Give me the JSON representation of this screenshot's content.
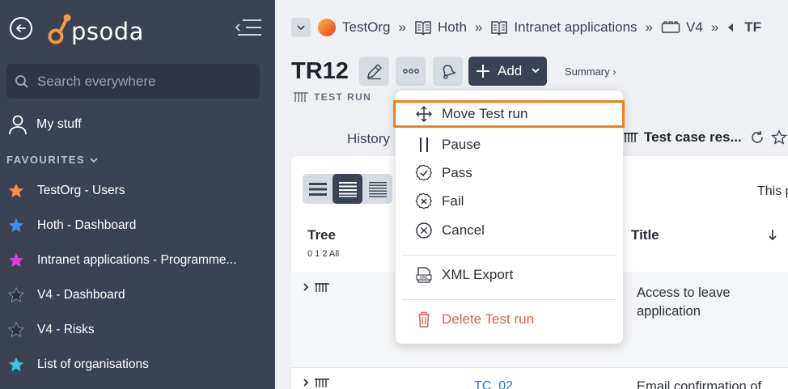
{
  "sidebar": {
    "logo_text": "psoda",
    "search_placeholder": "Search everywhere",
    "my_stuff": "My stuff",
    "favourites_header": "FAVOURITES",
    "favourites": [
      {
        "label": "TestOrg - Users",
        "star_color": "#f0904a"
      },
      {
        "label": "Hoth - Dashboard",
        "star_color": "#3b8fe8"
      },
      {
        "label": "Intranet applications - Programme...",
        "star_color": "#d63fd6"
      },
      {
        "label": "V4 - Dashboard",
        "star_color": "#2a2f3a"
      },
      {
        "label": "V4 - Risks",
        "star_color": "#2a2f3a"
      },
      {
        "label": "List of organisations",
        "star_color": "#3ec6d6"
      }
    ],
    "colors": {
      "bg": "#3b4252",
      "search_bg": "#2f3544"
    }
  },
  "breadcrumb": {
    "items": [
      {
        "label": "TestOrg",
        "icon": "org-logo-icon"
      },
      {
        "label": "Hoth",
        "icon": "book-icon"
      },
      {
        "label": "Intranet applications",
        "icon": "book-icon"
      },
      {
        "label": "V4",
        "icon": "folder-icon"
      }
    ],
    "separator": "»",
    "truncated": "TF"
  },
  "header": {
    "title": "TR12",
    "subtitle": "TEST RUN",
    "add_label": "Add",
    "summary_label": "Summary ›"
  },
  "tabs": {
    "history": "History",
    "test_case_results": "Test case res..."
  },
  "table": {
    "this_text": "This p",
    "col_tree": "Tree",
    "tree_levels": "0 1 2 All",
    "col_title": "Title",
    "rows": [
      {
        "id": "",
        "title": "Access to leave application"
      },
      {
        "id": "TC_02",
        "title": "Email confirmation of"
      }
    ]
  },
  "dropdown": {
    "items": [
      {
        "label": "Move Test run",
        "icon": "move-icon"
      },
      {
        "label": "Pause",
        "icon": "pause-icon"
      },
      {
        "label": "Pass",
        "icon": "pass-icon"
      },
      {
        "label": "Fail",
        "icon": "fail-icon"
      },
      {
        "label": "Cancel",
        "icon": "cancel-icon"
      },
      {
        "label": "XML Export",
        "icon": "xml-icon"
      },
      {
        "label": "Delete Test run",
        "icon": "trash-icon"
      }
    ],
    "highlight_color": "#f0801b",
    "danger_color": "#e35a5a"
  }
}
